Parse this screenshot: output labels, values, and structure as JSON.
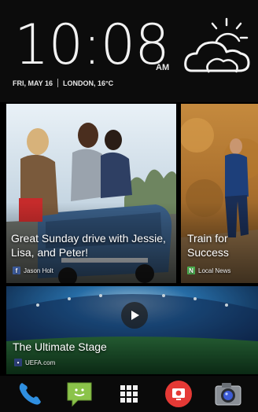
{
  "clock": {
    "time": "10:08",
    "ampm": "AM",
    "date": "FRI, MAY 16",
    "location_temp": "LONDON, 16°C"
  },
  "weather": {
    "icon": "partly-cloudy-icon"
  },
  "feed": {
    "items": [
      {
        "caption": "Great Sunday drive with Jessie, Lisa, and Peter!",
        "source": "Jason Holt",
        "source_icon": "facebook-icon"
      },
      {
        "caption": "Train for Success",
        "source": "Local News",
        "source_icon": "news-icon"
      },
      {
        "caption": "The Ultimate Stage",
        "source": "UEFA.com",
        "source_icon": "web-icon",
        "has_play": true
      }
    ]
  },
  "dock": {
    "apps": [
      {
        "name": "Phone",
        "icon": "phone-icon"
      },
      {
        "name": "Messages",
        "icon": "messages-icon"
      },
      {
        "name": "Apps",
        "icon": "app-grid-icon"
      },
      {
        "name": "Screen Recorder",
        "icon": "screen-record-icon"
      },
      {
        "name": "Camera",
        "icon": "camera-icon"
      }
    ]
  },
  "colors": {
    "facebook": "#3b5998",
    "news": "#4caf50",
    "messages": "#8bc34a",
    "phone": "#2f8fe0",
    "recorder": "#e53935"
  }
}
